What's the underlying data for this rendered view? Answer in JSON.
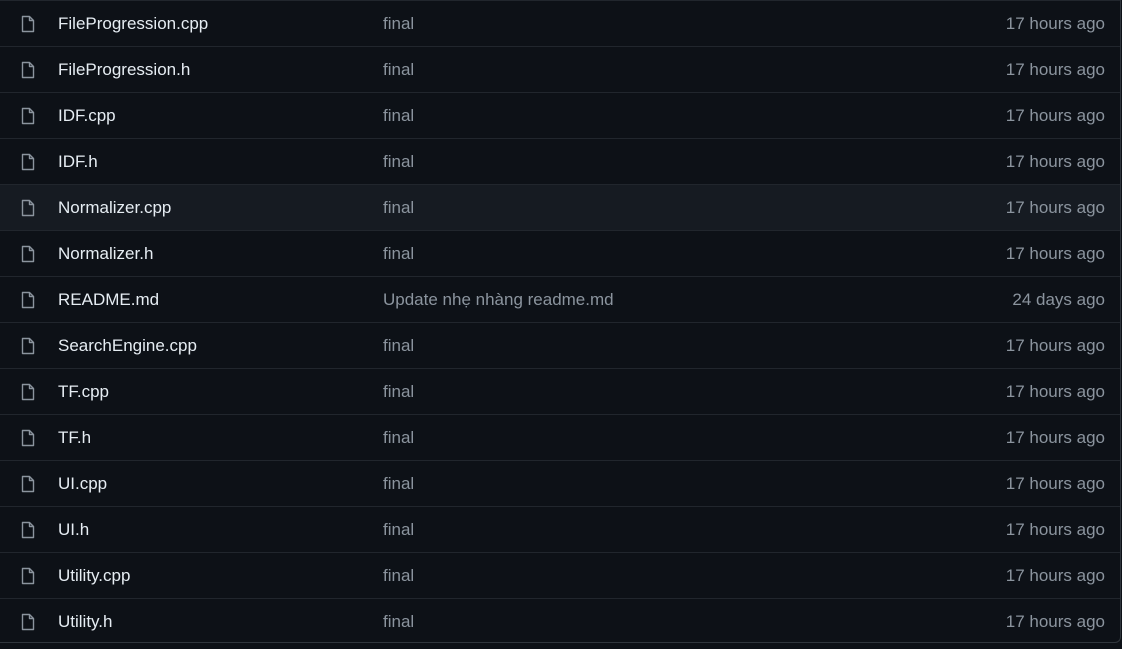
{
  "colors": {
    "background": "#0d1117",
    "row_hover": "#161b22",
    "divider": "#21262d",
    "filename_text": "#e6edf3",
    "muted_text": "#8b949e",
    "icon": "#8b949e"
  },
  "files": [
    {
      "name": "FileProgression.cpp",
      "icon": "file-icon",
      "commit_message": "final",
      "age": "17 hours ago"
    },
    {
      "name": "FileProgression.h",
      "icon": "file-icon",
      "commit_message": "final",
      "age": "17 hours ago"
    },
    {
      "name": "IDF.cpp",
      "icon": "file-icon",
      "commit_message": "final",
      "age": "17 hours ago"
    },
    {
      "name": "IDF.h",
      "icon": "file-icon",
      "commit_message": "final",
      "age": "17 hours ago"
    },
    {
      "name": "Normalizer.cpp",
      "icon": "file-icon",
      "commit_message": "final",
      "age": "17 hours ago",
      "hovered": true
    },
    {
      "name": "Normalizer.h",
      "icon": "file-icon",
      "commit_message": "final",
      "age": "17 hours ago"
    },
    {
      "name": "README.md",
      "icon": "file-icon",
      "commit_message": "Update nhẹ nhàng readme.md",
      "age": "24 days ago"
    },
    {
      "name": "SearchEngine.cpp",
      "icon": "file-icon",
      "commit_message": "final",
      "age": "17 hours ago"
    },
    {
      "name": "TF.cpp",
      "icon": "file-icon",
      "commit_message": "final",
      "age": "17 hours ago"
    },
    {
      "name": "TF.h",
      "icon": "file-icon",
      "commit_message": "final",
      "age": "17 hours ago"
    },
    {
      "name": "UI.cpp",
      "icon": "file-icon",
      "commit_message": "final",
      "age": "17 hours ago"
    },
    {
      "name": "UI.h",
      "icon": "file-icon",
      "commit_message": "final",
      "age": "17 hours ago"
    },
    {
      "name": "Utility.cpp",
      "icon": "file-icon",
      "commit_message": "final",
      "age": "17 hours ago"
    },
    {
      "name": "Utility.h",
      "icon": "file-icon",
      "commit_message": "final",
      "age": "17 hours ago"
    }
  ]
}
